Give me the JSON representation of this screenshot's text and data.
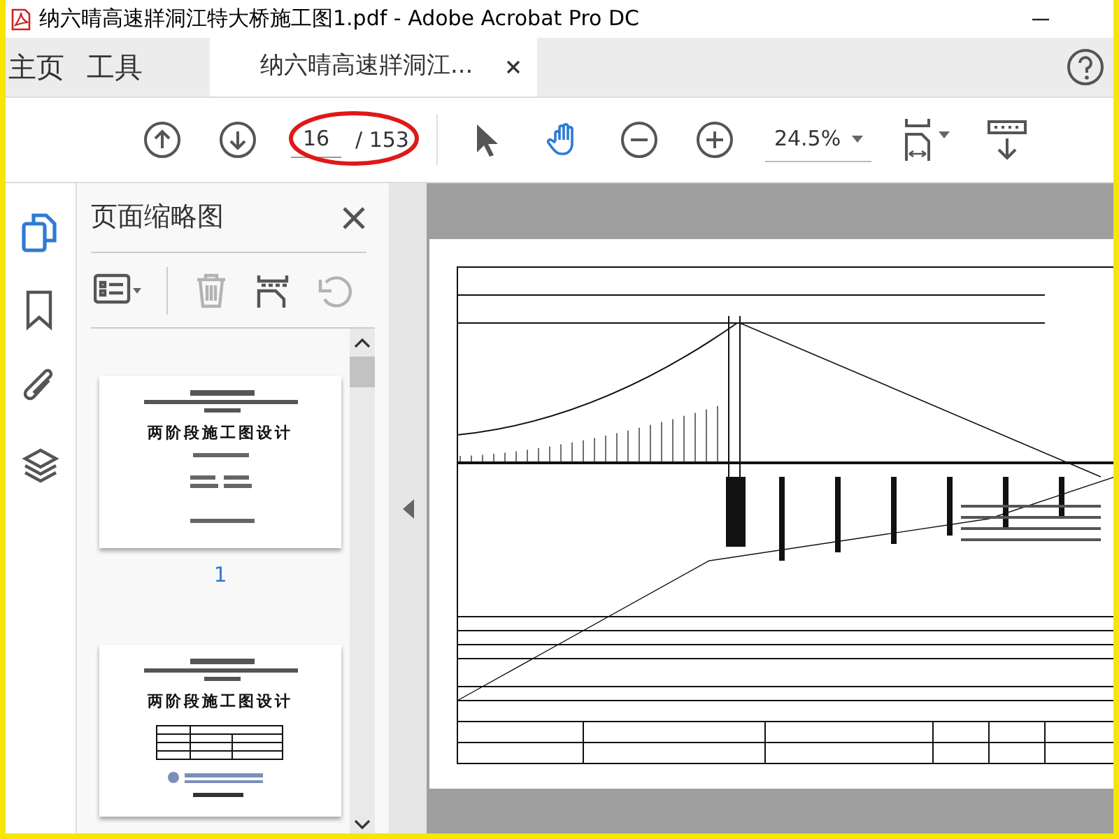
{
  "window": {
    "title": "纳六晴高速牂洞江特大桥施工图1.pdf - Adobe Acrobat Pro DC"
  },
  "tabs": [
    {
      "label": "主页",
      "selected": false
    },
    {
      "label": "工具",
      "selected": false
    },
    {
      "label": "纳六晴高速牂洞江...",
      "selected": true
    }
  ],
  "toolbar": {
    "page": "16",
    "total": "/ 153",
    "zoom": "24.5%",
    "tools": [
      {
        "kind": "select",
        "selected": false
      },
      {
        "kind": "hand",
        "selected": true
      }
    ]
  },
  "rail": [
    {
      "kind": "pages",
      "selected": true
    },
    {
      "kind": "bookmarks",
      "selected": false
    },
    {
      "kind": "attachments",
      "selected": false
    },
    {
      "kind": "layers",
      "selected": false
    }
  ],
  "panel": {
    "title": "页面缩略图",
    "actions": [
      {
        "kind": "options",
        "disabled": false
      },
      {
        "kind": "delete",
        "disabled": true
      },
      {
        "kind": "insert",
        "disabled": false
      },
      {
        "kind": "rotate",
        "disabled": true
      }
    ],
    "thumbnails": [
      {
        "heading": "两阶段施工图设计",
        "label": "1",
        "selected": false
      },
      {
        "heading": "两阶段施工图设计",
        "selected": false
      }
    ]
  }
}
